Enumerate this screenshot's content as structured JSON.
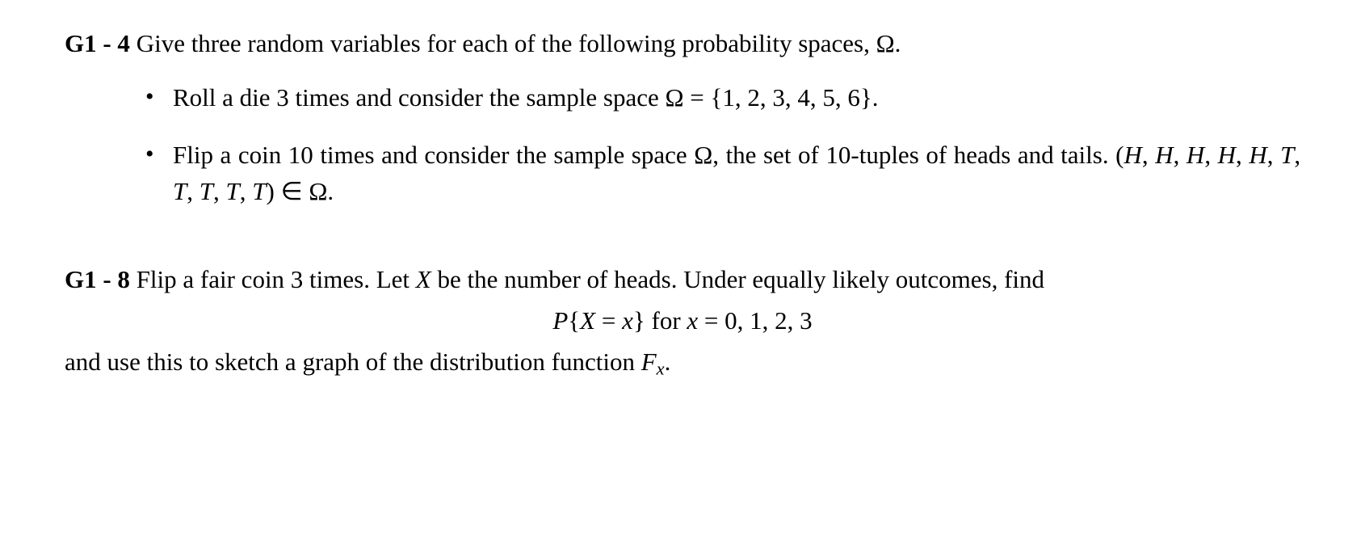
{
  "g1_4": {
    "label": "G1 - 4",
    "intro_a": " Give three random variables for each of the following probability spaces, ",
    "omega_period": "Ω.",
    "bullet1_a": "Roll a die 3 times and consider the sample space ",
    "bullet1_b": "Ω = {1, 2, 3, 4, 5, 6}.",
    "bullet2_a": "Flip a coin 10 times and consider the sample space ",
    "bullet2_b": "Ω",
    "bullet2_c": ", the set of 10-tuples of heads and tails. ",
    "bullet2_d": "(H, H, H, H, H, T, T, T, T, T) ∈ Ω."
  },
  "g1_8": {
    "label": "G1 - 8",
    "line1_a": " Flip a fair coin 3 times.  Let ",
    "line1_X": "X",
    "line1_b": " be the number of heads.  Under equally likely outcomes, find",
    "eq_a": "P{X = x}",
    "eq_b": " for ",
    "eq_c": "x = 0, 1, 2, 3",
    "line2_a": "and use this to sketch a graph of the distribution function ",
    "line2_F": "F",
    "line2_sub": "x",
    "line2_c": "."
  }
}
